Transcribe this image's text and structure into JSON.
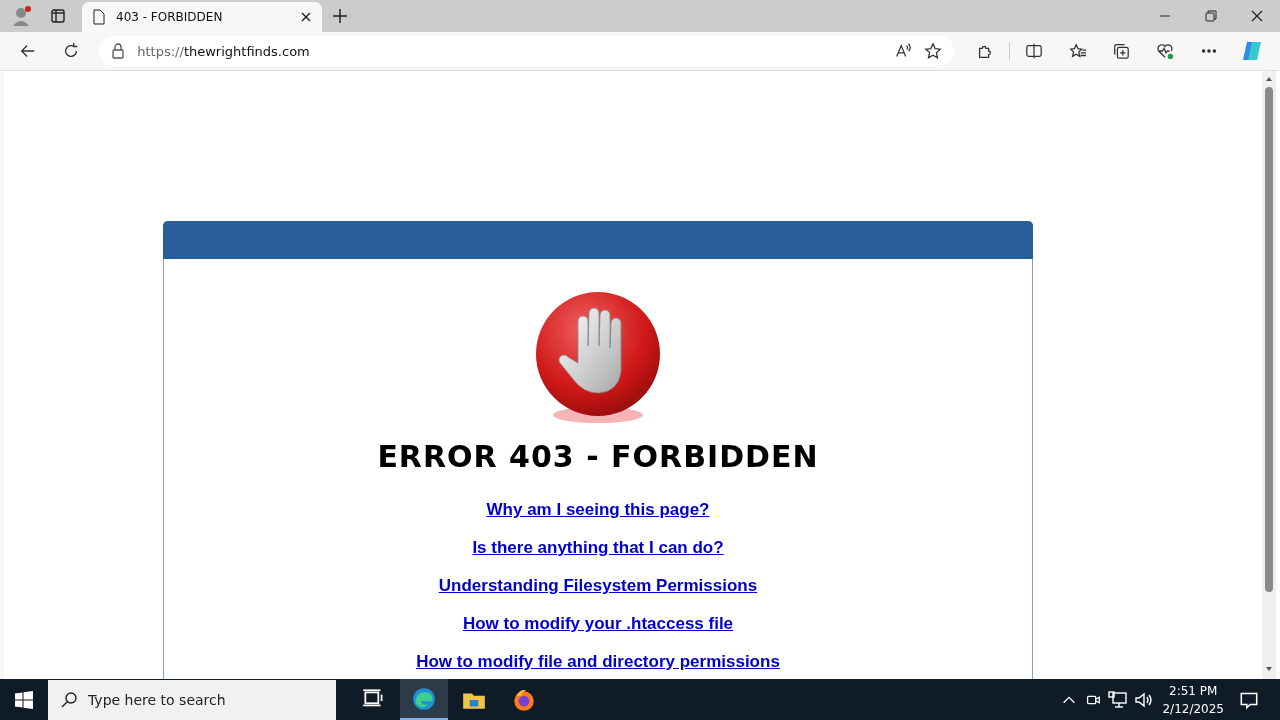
{
  "browser": {
    "tabs": [
      {
        "title": "403 - FORBIDDEN",
        "selected": true
      }
    ],
    "address": {
      "scheme": "https://",
      "host": "thewrightfinds.com"
    }
  },
  "page": {
    "heading": "ERROR 403 - FORBIDDEN",
    "links": [
      "Why am I seeing this page?",
      "Is there anything that I can do?",
      "Understanding Filesystem Permissions",
      "How to modify your .htaccess file",
      "How to modify file and directory permissions"
    ]
  },
  "taskbar": {
    "search": {
      "placeholder": "Type here to search"
    },
    "apps": [
      {
        "kind": "taskview",
        "active": false
      },
      {
        "kind": "edge",
        "active": true
      },
      {
        "kind": "explorer",
        "active": false
      },
      {
        "kind": "firefox",
        "active": false
      }
    ],
    "clock": {
      "time": "2:51 PM",
      "date": "2/12/2025"
    }
  }
}
